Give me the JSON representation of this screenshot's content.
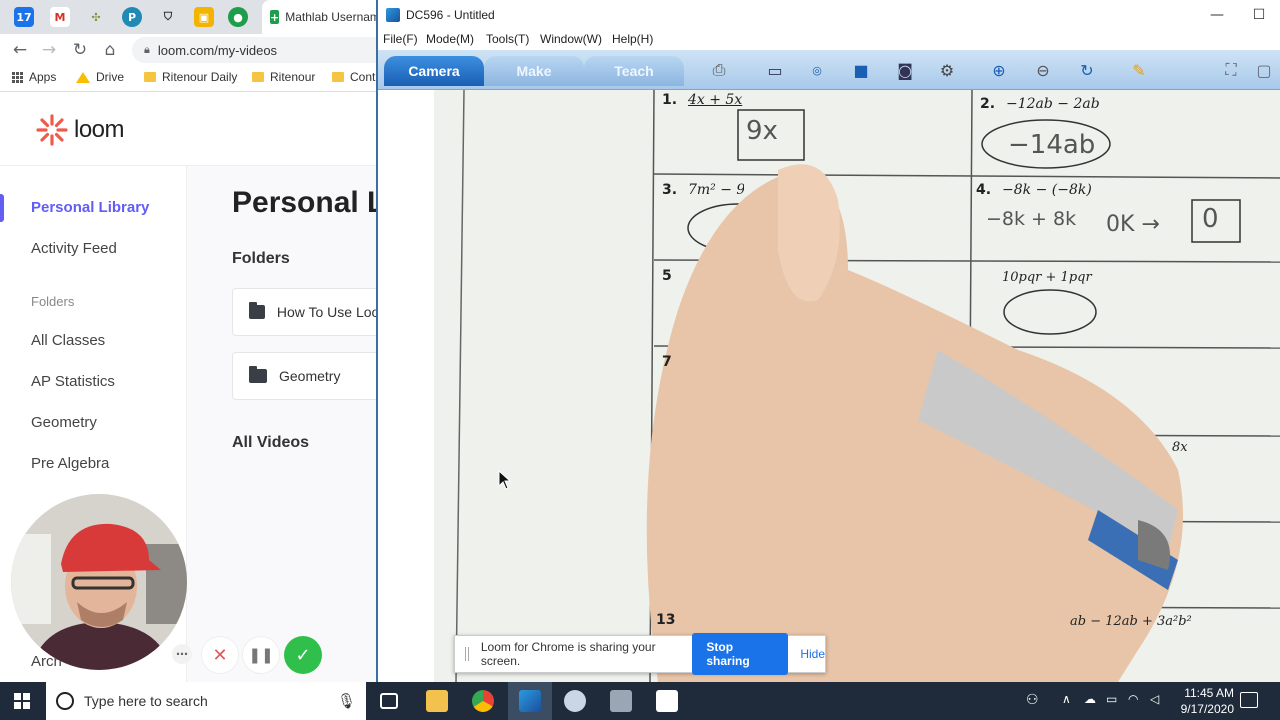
{
  "browser": {
    "tabs": [
      {
        "icon": "calendar-icon",
        "text": "17",
        "color": "#1a73e8"
      },
      {
        "icon": "gmail-icon",
        "text": "M",
        "color": "#d93025"
      },
      {
        "icon": "extension-icon",
        "text": "",
        "color": "#7a9b3a"
      },
      {
        "icon": "p-icon",
        "text": "P",
        "color": "#1f8bb5"
      },
      {
        "icon": "shield-icon",
        "text": "",
        "color": "#333"
      },
      {
        "icon": "classroom-icon",
        "text": "",
        "color": "#f2b400"
      },
      {
        "icon": "meet-icon",
        "text": "",
        "color": "#1e9e4a"
      }
    ],
    "active_tab_title": "Mathlab Username",
    "url": "loom.com/my-videos",
    "bookmarks": {
      "apps": "Apps",
      "drive": "Drive",
      "b1": "Ritenour Daily",
      "b2": "Ritenour",
      "b3": "Cont"
    }
  },
  "loom": {
    "brand": "loom",
    "sidebar": {
      "personal_library": "Personal Library",
      "activity_feed": "Activity Feed",
      "folders_heading": "Folders",
      "items": [
        "All Classes",
        "AP Statistics",
        "Geometry",
        "Pre Algebra"
      ],
      "archive_partial": "Arch"
    },
    "page_title": "Personal Library",
    "folders_heading": "Folders",
    "folders": [
      "How To Use Loom",
      "Geometry"
    ],
    "all_videos": "All Videos"
  },
  "app": {
    "title": "DC596 - Untitled",
    "menu": [
      "File(F)",
      "Mode(M)",
      "Tools(T)",
      "Window(W)",
      "Help(H)"
    ],
    "tabs": [
      "Camera",
      "Make",
      "Teach"
    ],
    "worksheet": {
      "p1_label": "1.",
      "p1_expr": "4x + 5x",
      "p1_answer": "9x",
      "p2_label": "2.",
      "p2_expr": "−12ab − 2ab",
      "p2_answer": "−14ab",
      "p3_label": "3.",
      "p3_expr": "7m² − 9m",
      "p4_label": "4.",
      "p4_expr": "−8k − (−8k)",
      "p4_work": "−8k + 8k",
      "p4_answer": "0K →",
      "p4_box": "0",
      "p5_label": "5",
      "p6_expr": "10pqr + 1pqr",
      "p7_label": "7",
      "p8_frag": "8x",
      "p13_label": "13",
      "p14_expr": "ab − 12ab + 3a²b²"
    }
  },
  "sharebar": {
    "message": "Loom for Chrome is sharing your screen.",
    "stop": "Stop sharing",
    "hide": "Hide"
  },
  "taskbar": {
    "search_placeholder": "Type here to search",
    "time": "11:45 AM",
    "date": "9/17/2020"
  },
  "colors": {
    "loom_accent": "#625df5",
    "stop_button": "#1a73e8",
    "record_done": "#2fbf4a",
    "cancel": "#e05a5a"
  }
}
